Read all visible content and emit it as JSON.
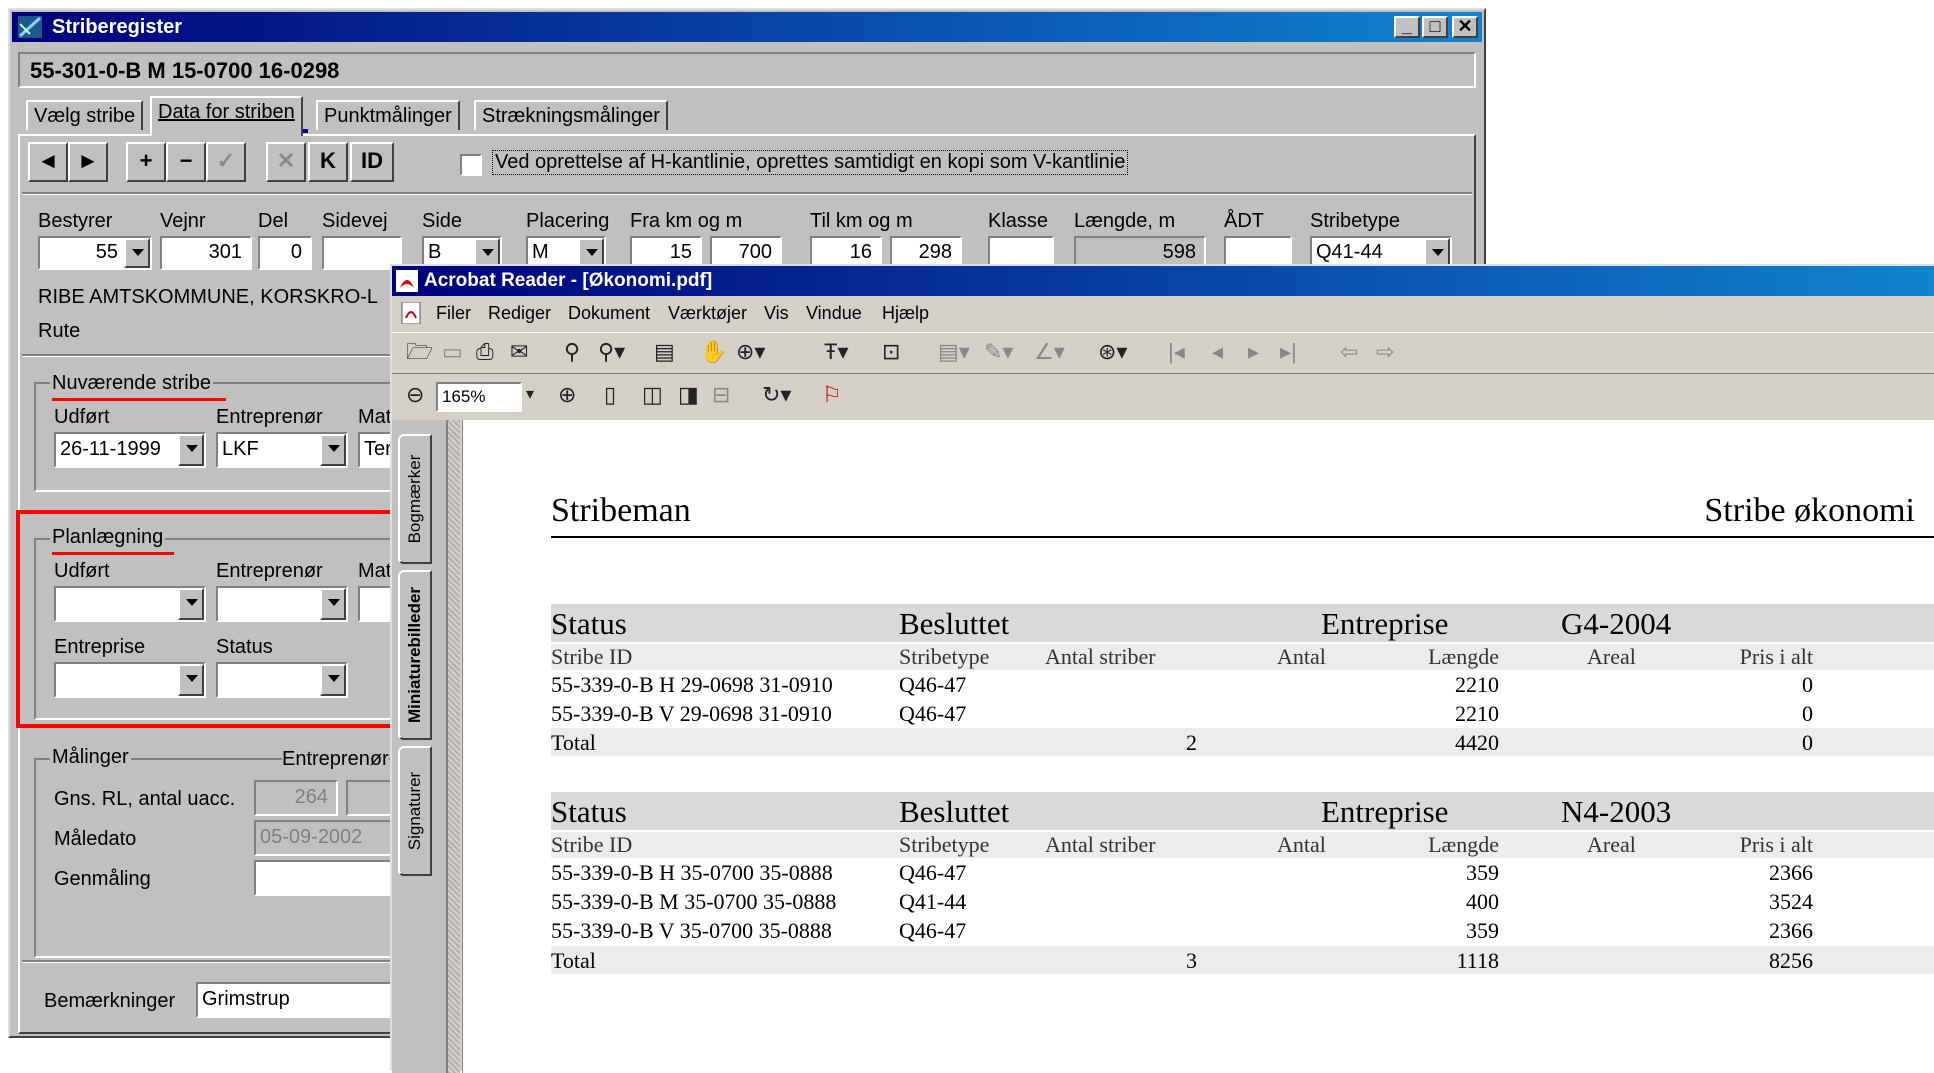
{
  "striberegister": {
    "title": "Striberegister",
    "record_id": "55-301-0-B  M  15-0700  16-0298",
    "tabs": [
      "Vælg stribe",
      "Data for striben",
      "Punktmålinger",
      "Strækningsmålinger"
    ],
    "toolbar": {
      "k_label": "K",
      "id_label": "ID"
    },
    "checkbox_label": "Ved oprettelse af H-kantlinie, oprettes samtidigt en kopi som V-kantlinie",
    "fields": {
      "bestyrer": {
        "label": "Bestyrer",
        "value": "55"
      },
      "vejnr": {
        "label": "Vejnr",
        "value": "301"
      },
      "del": {
        "label": "Del",
        "value": "0"
      },
      "sidevej": {
        "label": "Sidevej",
        "value": ""
      },
      "side": {
        "label": "Side",
        "value": "B"
      },
      "placering": {
        "label": "Placering",
        "value": "M"
      },
      "fra": {
        "label": "Fra km og m",
        "km": "15",
        "m": "700"
      },
      "til": {
        "label": "Til km og m",
        "km": "16",
        "m": "298"
      },
      "klasse": {
        "label": "Klasse",
        "value": ""
      },
      "laengde": {
        "label": "Længde, m",
        "value": "598"
      },
      "adt": {
        "label": "ÅDT",
        "value": ""
      },
      "stribetype": {
        "label": "Stribetype",
        "value": "Q41-44"
      }
    },
    "owner_text": "RIBE AMTSKOMMUNE, KORSKRO-L",
    "rute_label": "Rute",
    "nuvaerende": {
      "title": "Nuværende stribe",
      "udfoert_label": "Udført",
      "udfoert_value": "26-11-1999",
      "entreprenoer_label": "Entreprenør",
      "entreprenoer_value": "LKF",
      "mat_label": "Mat",
      "mat_value": "Ter"
    },
    "planlaegning": {
      "title": "Planlægning",
      "udfoert_label": "Udført",
      "entreprenoer_label": "Entreprenør",
      "mat_label": "Mat",
      "entreprise_label": "Entreprise",
      "status_label": "Status"
    },
    "maalinger": {
      "title": "Målinger",
      "entreprenoer_label": "Entreprenør",
      "rl_label": "Gns. RL, antal uacc.",
      "rl_value": "264",
      "maaledato_label": "Måledato",
      "maaledato_value": "05-09-2002",
      "genmaaling_label": "Genmåling"
    },
    "bemaerkninger": {
      "label": "Bemærkninger",
      "value": "Grimstrup"
    }
  },
  "acrobat": {
    "title": "Acrobat Reader - [Økonomi.pdf]",
    "menu": [
      "Filer",
      "Rediger",
      "Dokument",
      "Værktøjer",
      "Vis",
      "Vindue",
      "Hjælp"
    ],
    "zoom": "165%",
    "side_tabs": [
      "Bogmærker",
      "Miniaturebilleder",
      "Signaturer"
    ],
    "document": {
      "left_heading": "Stribeman",
      "right_heading": "Stribe økonomi",
      "columns": [
        "Stribe ID",
        "Stribetype",
        "Antal striber",
        "Antal",
        "Længde",
        "Areal",
        "Pris i alt"
      ],
      "sections": [
        {
          "status_label": "Status",
          "status_value": "Besluttet",
          "entreprise_label": "Entreprise",
          "entreprise_value": "G4-2004",
          "rows": [
            [
              "55-339-0-B H 29-0698 31-0910",
              "Q46-47",
              "",
              "",
              "2210",
              "",
              "0"
            ],
            [
              "55-339-0-B V 29-0698 31-0910",
              "Q46-47",
              "",
              "",
              "2210",
              "",
              "0"
            ]
          ],
          "total": [
            "Total",
            "",
            "2",
            "",
            "4420",
            "",
            "0"
          ]
        },
        {
          "status_label": "Status",
          "status_value": "Besluttet",
          "entreprise_label": "Entreprise",
          "entreprise_value": "N4-2003",
          "rows": [
            [
              "55-339-0-B H 35-0700 35-0888",
              "Q46-47",
              "",
              "",
              "359",
              "",
              "2366"
            ],
            [
              "55-339-0-B M 35-0700 35-0888",
              "Q41-44",
              "",
              "",
              "400",
              "",
              "3524"
            ],
            [
              "55-339-0-B V 35-0700 35-0888",
              "Q46-47",
              "",
              "",
              "359",
              "",
              "2366"
            ]
          ],
          "total": [
            "Total",
            "",
            "3",
            "",
            "1118",
            "",
            "8256"
          ]
        }
      ]
    }
  },
  "colors": {
    "titlebar": "#00007b",
    "highlight": "#ff0000",
    "band": "#d9d9d9"
  }
}
